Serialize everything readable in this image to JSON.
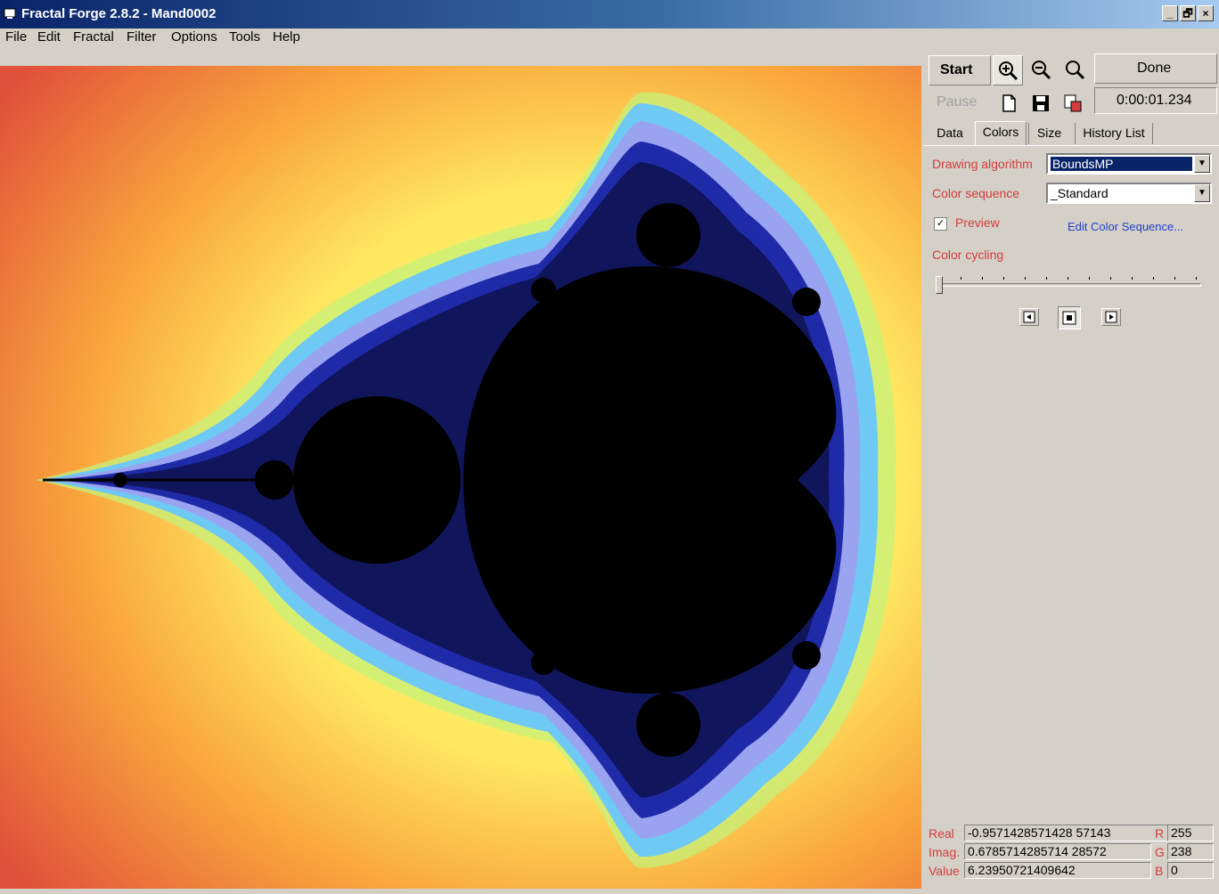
{
  "window": {
    "title": "Fractal Forge 2.8.2 - Mand0002",
    "buttons": [
      "_",
      "🗗",
      "×"
    ]
  },
  "menu": [
    "File",
    "Edit",
    "Fractal",
    "Filter",
    "Options",
    "Tools",
    "Help"
  ],
  "toolbar": {
    "start_label": "Start",
    "pause_label": "Pause",
    "done_label": "Done",
    "timer": "0:00:01.234",
    "icons": [
      "zoom-in-icon",
      "zoom-out-icon",
      "zoom-icon",
      "new-icon",
      "save-icon",
      "copy-icon"
    ]
  },
  "tabs": [
    {
      "label": "Data"
    },
    {
      "label": "Colors"
    },
    {
      "label": "Size"
    },
    {
      "label": "History List"
    }
  ],
  "colors_tab": {
    "drawing_algorithm_label": "Drawing algorithm",
    "drawing_algorithm_value": "BoundsMP",
    "color_sequence_label": "Color sequence",
    "color_sequence_value": "_Standard",
    "preview_label": "Preview",
    "preview_checked": true,
    "edit_link": "Edit Color Sequence...",
    "color_cycling_label": "Color cycling"
  },
  "status": {
    "real_label": "Real",
    "real_value": "-0.9571428571428 57143",
    "imag_label": "Imag.",
    "imag_value": "0.6785714285714 28572",
    "value_label": "Value",
    "value_value": "6.23950721409642",
    "r_label": "R",
    "r_value": "255",
    "g_label": "G",
    "g_value": "238",
    "b_label": "B",
    "b_value": "0"
  },
  "theme": {
    "accent_red": "#d23c3c",
    "link_blue": "#2340c8",
    "face": "#d4d0c8"
  }
}
